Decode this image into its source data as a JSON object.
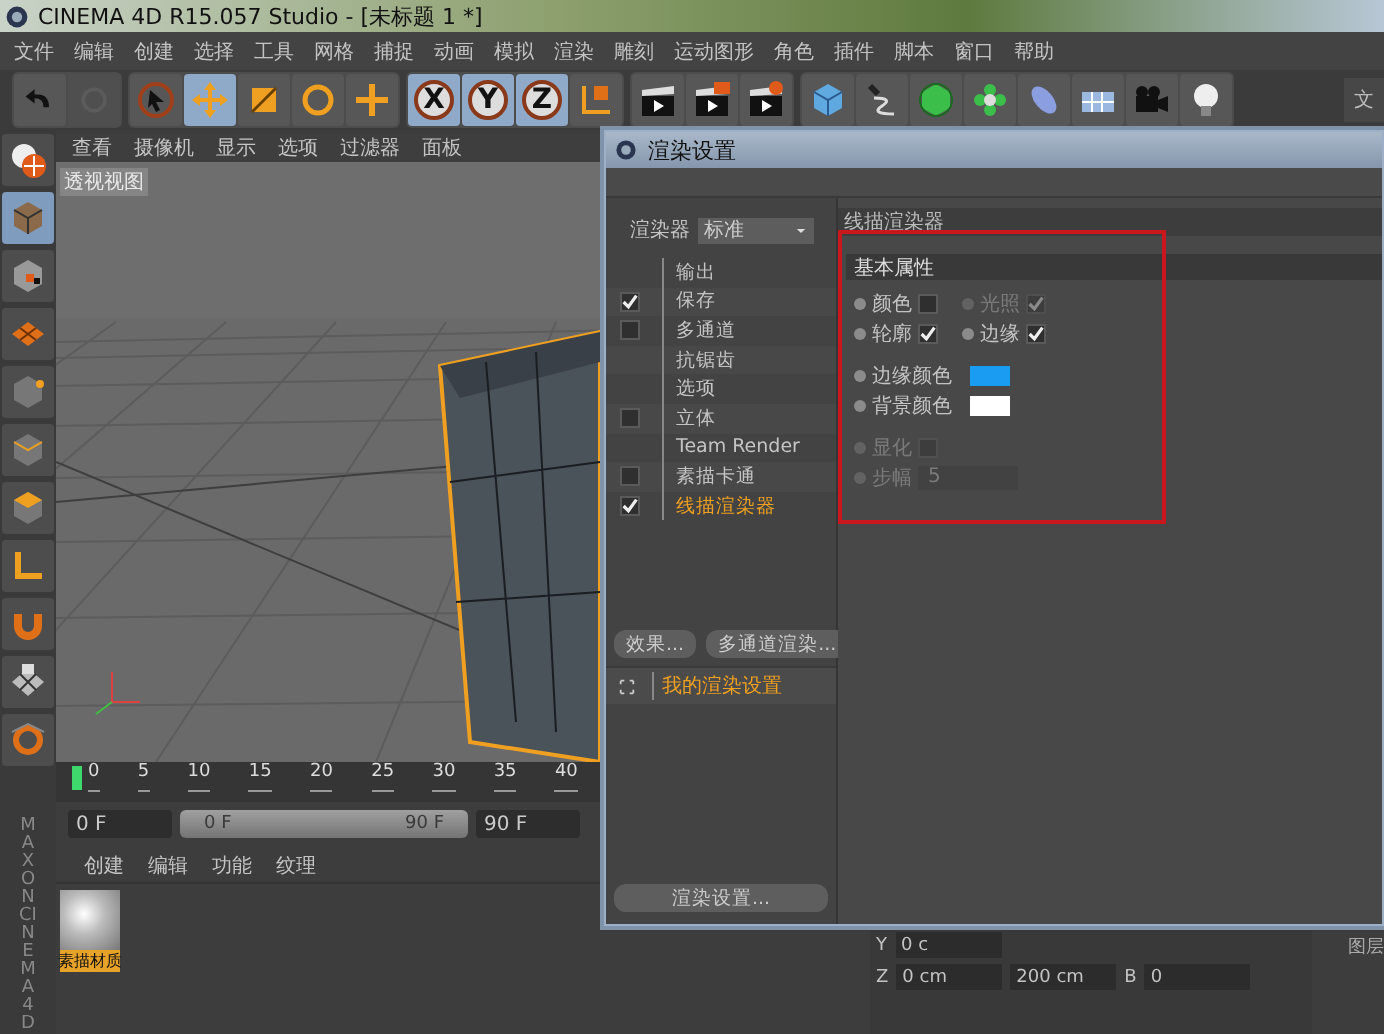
{
  "window": {
    "title": "CINEMA 4D R15.057 Studio - [未标题 1 *]"
  },
  "menu_bar": [
    "文件",
    "编辑",
    "创建",
    "选择",
    "工具",
    "网格",
    "捕捉",
    "动画",
    "模拟",
    "渲染",
    "雕刻",
    "运动图形",
    "角色",
    "插件",
    "脚本",
    "窗口",
    "帮助"
  ],
  "toolbar": {
    "history": [
      {
        "disabled": false
      },
      {
        "disabled": true
      }
    ],
    "tools": [
      {
        "selected": false
      },
      {
        "selected": true
      },
      {
        "selected": false
      },
      {
        "selected": false
      },
      {
        "selected": false
      }
    ],
    "axes": [
      {
        "label": "X",
        "selected": true
      },
      {
        "label": "Y",
        "selected": true
      },
      {
        "label": "Z",
        "selected": true
      }
    ]
  },
  "side_panel_tab": "文",
  "left_tools": [
    {
      "selected": false
    },
    {
      "selected": true
    },
    {
      "selected": false
    },
    {
      "selected": false
    },
    {
      "selected": false
    },
    {
      "selected": false
    },
    {
      "selected": false
    },
    {
      "selected": false
    },
    {
      "selected": false
    },
    {
      "selected": false
    },
    {
      "selected": false
    }
  ],
  "viewport": {
    "menu": [
      "查看",
      "摄像机",
      "显示",
      "选项",
      "过滤器",
      "面板"
    ],
    "label": "透视视图"
  },
  "timeline": {
    "ticks": [
      "0",
      "5",
      "10",
      "15",
      "20",
      "25",
      "30",
      "35",
      "40"
    ],
    "start": "0 F",
    "range_start": "0 F",
    "range_end": "90 F",
    "end": "90 F"
  },
  "material_manager": {
    "menu": [
      "创建",
      "编辑",
      "功能",
      "纹理"
    ],
    "materials": [
      {
        "name": "素描材质",
        "selected": true
      }
    ]
  },
  "logo": {
    "brand": "MAXON",
    "product": "CINEMA 4D"
  },
  "coordinates": {
    "rows": [
      {
        "axis": "Y",
        "position": "0 c"
      },
      {
        "axis": "Z",
        "position": "0 cm",
        "size": "200 cm",
        "angle_label": "B",
        "angle": "0"
      }
    ]
  },
  "attributes_label": "图层",
  "render_settings": {
    "title": "渲染设置",
    "renderer_label": "渲染器",
    "renderer": "标准",
    "tree": [
      {
        "label": "输出",
        "kind": "plain",
        "selected": false
      },
      {
        "label": "保存",
        "kind": "checkbox",
        "checked": true,
        "selected": false
      },
      {
        "label": "多通道",
        "kind": "checkbox",
        "checked": false,
        "selected": false
      },
      {
        "label": "抗锯齿",
        "kind": "plain",
        "selected": false
      },
      {
        "label": "选项",
        "kind": "plain",
        "selected": false
      },
      {
        "label": "立体",
        "kind": "checkbox",
        "checked": false,
        "selected": false
      },
      {
        "label": "Team Render",
        "kind": "plain",
        "selected": false
      },
      {
        "label": "素描卡通",
        "kind": "checkbox",
        "checked": false,
        "selected": false
      },
      {
        "label": "线描渲染器",
        "kind": "checkbox",
        "checked": true,
        "selected": true
      }
    ],
    "buttons": [
      "效果...",
      "多通道渲染..."
    ],
    "presets": [
      {
        "label": "我的渲染设置",
        "selected": true
      }
    ],
    "settings_button": "渲染设置...",
    "panel": {
      "title": "线描渲染器",
      "section": "基本属性",
      "rows": [
        [
          {
            "label": "颜色",
            "kind": "checkbox",
            "checked": false,
            "disabled": false
          },
          {
            "label": "光照",
            "kind": "checkbox",
            "checked": true,
            "disabled": true
          }
        ],
        [
          {
            "label": "轮廓",
            "kind": "checkbox",
            "checked": true,
            "disabled": false
          },
          {
            "label": "边缘",
            "kind": "checkbox",
            "checked": true,
            "disabled": false
          }
        ],
        [
          {
            "label": "边缘颜色",
            "kind": "color",
            "color": "#1a9cf2",
            "disabled": false
          }
        ],
        [
          {
            "label": "背景颜色",
            "kind": "color",
            "color": "#ffffff",
            "disabled": false
          }
        ],
        [
          {
            "label": "显化",
            "kind": "checkbox",
            "checked": false,
            "disabled": true
          }
        ],
        [
          {
            "label": "步幅",
            "kind": "number",
            "value": "5",
            "disabled": true
          }
        ]
      ]
    }
  }
}
